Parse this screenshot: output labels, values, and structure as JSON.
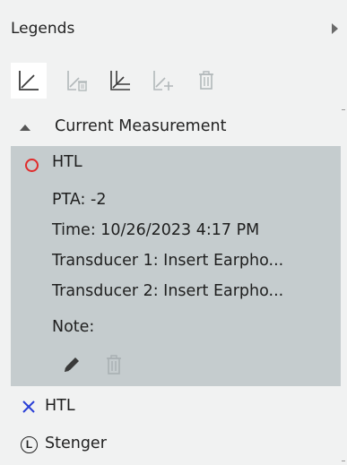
{
  "panel": {
    "title": "Legends",
    "collapse_icon": "triangle-right-icon"
  },
  "toolbar": {
    "buttons": [
      {
        "icon": "chart-line-icon",
        "state": "active"
      },
      {
        "icon": "chart-delete-icon",
        "state": "disabled"
      },
      {
        "icon": "chart-overlay-icon",
        "state": "enabled"
      },
      {
        "icon": "chart-add-icon",
        "state": "disabled"
      },
      {
        "icon": "trash-icon",
        "state": "disabled"
      }
    ]
  },
  "section": {
    "label": "Current Measurement",
    "expanded": true
  },
  "current": {
    "name": "HTL",
    "marker_color": "#e02b2b",
    "pta": "PTA: -2",
    "time": "Time: 10/26/2023 4:17 PM",
    "transducer1": "Transducer 1: Insert Earpho...",
    "transducer2": "Transducer 2: Insert Earpho...",
    "note": "Note:"
  },
  "legend_items": [
    {
      "label": "HTL",
      "marker": "x-icon",
      "color": "#2a3fd6"
    },
    {
      "label": "Stenger",
      "marker": "circle-l-icon",
      "color": "#222222"
    }
  ],
  "colors": {
    "background": "#f1f2f2",
    "card": "#c5ccce",
    "active_button": "#ffffff",
    "disabled_icon": "#a9b0b3"
  }
}
